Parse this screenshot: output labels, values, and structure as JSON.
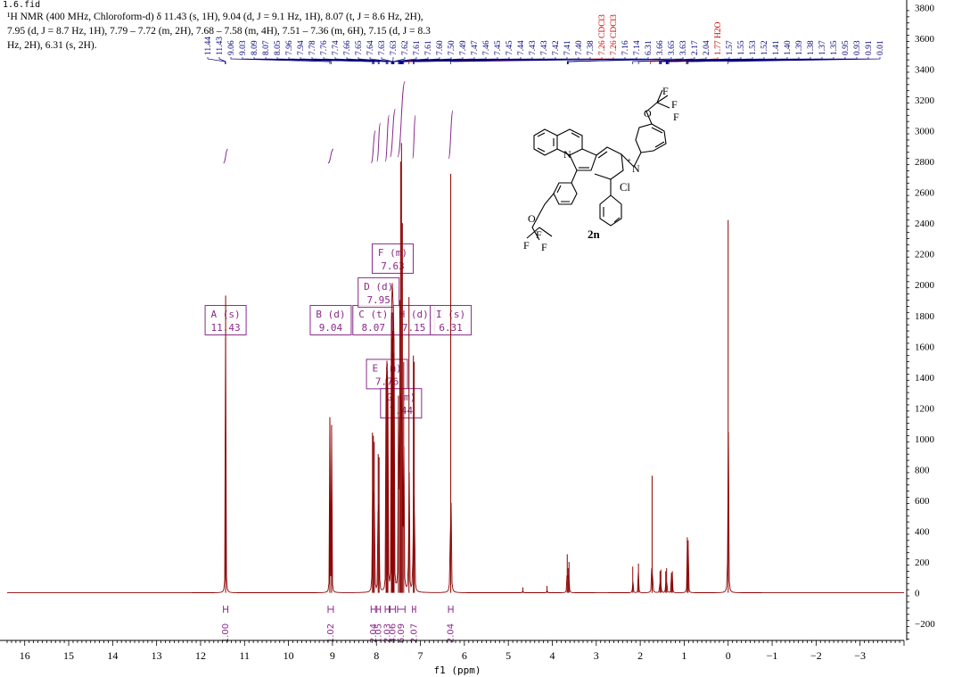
{
  "file_name": "1.6.fid",
  "header_lines": [
    "¹H NMR (400 MHz, Chloroform-d) δ 11.43 (s, 1H), 9.04 (d, J = 9.1 Hz, 1H), 8.07 (t, J = 8.6 Hz, 2H),",
    "7.95 (d, J = 8.7 Hz, 1H), 7.79 – 7.72 (m, 2H), 7.68 – 7.58 (m, 4H), 7.51 – 7.36 (m, 6H), 7.15 (d, J = 8.3",
    "Hz, 2H), 6.31 (s, 2H)."
  ],
  "colors": {
    "spectrum": "#8b0000",
    "multiplet": "#8a2a8a",
    "peak_label": "#00007f",
    "solvent_label": "#cc0000",
    "axis": "#000000"
  },
  "structure": {
    "compound_label": "2n",
    "atoms": [
      "N",
      "+",
      "N",
      "Cl",
      "O",
      "F",
      "F",
      "F",
      "O",
      "F",
      "F",
      "F"
    ]
  },
  "chart_data": {
    "type": "line",
    "title": "",
    "xlabel": "f1 (ppm)",
    "ylabel": "",
    "xlim": [
      16.4,
      -4.0
    ],
    "ylim": [
      -350,
      3820
    ],
    "x_reversed": true,
    "xticks": [
      16,
      15,
      14,
      13,
      12,
      11,
      10,
      9,
      8,
      7,
      6,
      5,
      4,
      3,
      2,
      1,
      0,
      -1,
      -2,
      -3
    ],
    "xtick_labels": [
      "16",
      "15",
      "14",
      "13",
      "12",
      "11",
      "10",
      "9",
      "8",
      "7",
      "6",
      "5",
      "4",
      "3",
      "2",
      "1",
      "0",
      "−1",
      "−2",
      "−3"
    ],
    "yticks": [
      -200,
      0,
      200,
      400,
      600,
      800,
      1000,
      1200,
      1400,
      1600,
      1800,
      2000,
      2200,
      2400,
      2600,
      2800,
      3000,
      3200,
      3400,
      3600,
      3800
    ],
    "ytick_labels": [
      "−200",
      "0",
      "200",
      "400",
      "600",
      "800",
      "1000",
      "1200",
      "1400",
      "1600",
      "1800",
      "2000",
      "2200",
      "2400",
      "2600",
      "2800",
      "3000",
      "3200",
      "3400",
      "3600",
      "3800"
    ],
    "peaks": [
      {
        "ppm": 11.43,
        "height": 1930
      },
      {
        "ppm": 9.06,
        "height": 1140
      },
      {
        "ppm": 9.02,
        "height": 1090
      },
      {
        "ppm": 8.09,
        "height": 1040
      },
      {
        "ppm": 8.07,
        "height": 1020
      },
      {
        "ppm": 8.05,
        "height": 980
      },
      {
        "ppm": 7.96,
        "height": 900
      },
      {
        "ppm": 7.94,
        "height": 880
      },
      {
        "ppm": 7.78,
        "height": 1390
      },
      {
        "ppm": 7.76,
        "height": 1500
      },
      {
        "ppm": 7.74,
        "height": 1280
      },
      {
        "ppm": 7.66,
        "height": 1650
      },
      {
        "ppm": 7.64,
        "height": 1820
      },
      {
        "ppm": 7.62,
        "height": 1700
      },
      {
        "ppm": 7.6,
        "height": 1560
      },
      {
        "ppm": 7.5,
        "height": 1280
      },
      {
        "ppm": 7.47,
        "height": 1900
      },
      {
        "ppm": 7.45,
        "height": 2800
      },
      {
        "ppm": 7.43,
        "height": 2920
      },
      {
        "ppm": 7.41,
        "height": 2400
      },
      {
        "ppm": 7.38,
        "height": 1500
      },
      {
        "ppm": 7.26,
        "height": 1920
      },
      {
        "ppm": 7.16,
        "height": 1540
      },
      {
        "ppm": 7.14,
        "height": 1500
      },
      {
        "ppm": 6.31,
        "height": 2720
      },
      {
        "ppm": 4.67,
        "height": 35
      },
      {
        "ppm": 4.12,
        "height": 45
      },
      {
        "ppm": 3.66,
        "height": 250
      },
      {
        "ppm": 3.64,
        "height": 160
      },
      {
        "ppm": 3.62,
        "height": 200
      },
      {
        "ppm": 2.17,
        "height": 170
      },
      {
        "ppm": 2.04,
        "height": 190
      },
      {
        "ppm": 1.73,
        "height": 760
      },
      {
        "ppm": 1.55,
        "height": 140
      },
      {
        "ppm": 1.53,
        "height": 150
      },
      {
        "ppm": 1.42,
        "height": 140
      },
      {
        "ppm": 1.4,
        "height": 160
      },
      {
        "ppm": 1.29,
        "height": 130
      },
      {
        "ppm": 1.27,
        "height": 140
      },
      {
        "ppm": 0.93,
        "height": 360
      },
      {
        "ppm": 0.91,
        "height": 340
      },
      {
        "ppm": 0.0,
        "height": 2420
      }
    ],
    "peak_labels": [
      {
        "text": "11.44",
        "ppm": 11.44,
        "solvent": false
      },
      {
        "text": "11.43",
        "ppm": 11.43,
        "solvent": false
      },
      {
        "text": "9.06",
        "ppm": 9.06,
        "solvent": false
      },
      {
        "text": "9.03",
        "ppm": 9.03,
        "solvent": false
      },
      {
        "text": "8.09",
        "ppm": 8.09,
        "solvent": false
      },
      {
        "text": "8.07",
        "ppm": 8.07,
        "solvent": false
      },
      {
        "text": "8.05",
        "ppm": 8.05,
        "solvent": false
      },
      {
        "text": "7.96",
        "ppm": 7.96,
        "solvent": false
      },
      {
        "text": "7.94",
        "ppm": 7.94,
        "solvent": false
      },
      {
        "text": "7.78",
        "ppm": 7.78,
        "solvent": false
      },
      {
        "text": "7.76",
        "ppm": 7.76,
        "solvent": false
      },
      {
        "text": "7.74",
        "ppm": 7.74,
        "solvent": false
      },
      {
        "text": "7.66",
        "ppm": 7.66,
        "solvent": false
      },
      {
        "text": "7.65",
        "ppm": 7.65,
        "solvent": false
      },
      {
        "text": "7.64",
        "ppm": 7.64,
        "solvent": false
      },
      {
        "text": "7.63",
        "ppm": 7.63,
        "solvent": false
      },
      {
        "text": "7.63",
        "ppm": 7.63,
        "solvent": false
      },
      {
        "text": "7.62",
        "ppm": 7.62,
        "solvent": false
      },
      {
        "text": "7.61",
        "ppm": 7.61,
        "solvent": false
      },
      {
        "text": "7.61",
        "ppm": 7.61,
        "solvent": false
      },
      {
        "text": "7.60",
        "ppm": 7.6,
        "solvent": false
      },
      {
        "text": "7.50",
        "ppm": 7.5,
        "solvent": false
      },
      {
        "text": "7.49",
        "ppm": 7.49,
        "solvent": false
      },
      {
        "text": "7.47",
        "ppm": 7.47,
        "solvent": false
      },
      {
        "text": "7.46",
        "ppm": 7.46,
        "solvent": false
      },
      {
        "text": "7.45",
        "ppm": 7.45,
        "solvent": false
      },
      {
        "text": "7.45",
        "ppm": 7.45,
        "solvent": false
      },
      {
        "text": "7.44",
        "ppm": 7.44,
        "solvent": false
      },
      {
        "text": "7.43",
        "ppm": 7.43,
        "solvent": false
      },
      {
        "text": "7.43",
        "ppm": 7.43,
        "solvent": false
      },
      {
        "text": "7.42",
        "ppm": 7.42,
        "solvent": false
      },
      {
        "text": "7.41",
        "ppm": 7.41,
        "solvent": false
      },
      {
        "text": "7.40",
        "ppm": 7.4,
        "solvent": false
      },
      {
        "text": "7.38",
        "ppm": 7.38,
        "solvent": false
      },
      {
        "text": "7.26 CDCl3",
        "ppm": 7.26,
        "solvent": true
      },
      {
        "text": "7.26 CDCl3",
        "ppm": 7.26,
        "solvent": true
      },
      {
        "text": "7.16",
        "ppm": 7.16,
        "solvent": false
      },
      {
        "text": "7.14",
        "ppm": 7.14,
        "solvent": false
      },
      {
        "text": "6.31",
        "ppm": 6.31,
        "solvent": false
      },
      {
        "text": "3.66",
        "ppm": 3.66,
        "solvent": false
      },
      {
        "text": "3.65",
        "ppm": 3.65,
        "solvent": false
      },
      {
        "text": "3.63",
        "ppm": 3.63,
        "solvent": false
      },
      {
        "text": "2.17",
        "ppm": 2.17,
        "solvent": false
      },
      {
        "text": "2.04",
        "ppm": 2.04,
        "solvent": false
      },
      {
        "text": "1.77 H2O",
        "ppm": 1.77,
        "solvent": true
      },
      {
        "text": "1.57",
        "ppm": 1.57,
        "solvent": false
      },
      {
        "text": "1.55",
        "ppm": 1.55,
        "solvent": false
      },
      {
        "text": "1.53",
        "ppm": 1.53,
        "solvent": false
      },
      {
        "text": "1.52",
        "ppm": 1.52,
        "solvent": false
      },
      {
        "text": "1.41",
        "ppm": 1.41,
        "solvent": false
      },
      {
        "text": "1.40",
        "ppm": 1.4,
        "solvent": false
      },
      {
        "text": "1.39",
        "ppm": 1.39,
        "solvent": false
      },
      {
        "text": "1.38",
        "ppm": 1.38,
        "solvent": false
      },
      {
        "text": "1.37",
        "ppm": 1.37,
        "solvent": false
      },
      {
        "text": "1.35",
        "ppm": 1.35,
        "solvent": false
      },
      {
        "text": "0.95",
        "ppm": 0.95,
        "solvent": false
      },
      {
        "text": "0.93",
        "ppm": 0.93,
        "solvent": false
      },
      {
        "text": "0.91",
        "ppm": 0.91,
        "solvent": false
      },
      {
        "text": "0.01",
        "ppm": 0.01,
        "solvent": false
      }
    ],
    "multiplets": [
      {
        "id": "A",
        "mult": "(s)",
        "shift": "11.43",
        "ppm": 11.43,
        "label_y": 1770
      },
      {
        "id": "B",
        "mult": "(d)",
        "shift": "9.04",
        "ppm": 9.04,
        "label_y": 1770
      },
      {
        "id": "C",
        "mult": "(t)",
        "shift": "8.07",
        "ppm": 8.07,
        "label_y": 1770
      },
      {
        "id": "D",
        "mult": "(d)",
        "shift": "7.95",
        "ppm": 7.95,
        "label_y": 1950
      },
      {
        "id": "E",
        "mult": "(m)",
        "shift": "7.76",
        "ppm": 7.76,
        "label_y": 1420
      },
      {
        "id": "F",
        "mult": "(m)",
        "shift": "7.63",
        "ppm": 7.63,
        "label_y": 2170
      },
      {
        "id": "G",
        "mult": "(m)",
        "shift": "7.44",
        "ppm": 7.44,
        "label_y": 1230
      },
      {
        "id": "H",
        "mult": "(d)",
        "shift": "7.15",
        "ppm": 7.15,
        "label_y": 1770
      },
      {
        "id": "I",
        "mult": "(s)",
        "shift": "6.31",
        "ppm": 6.31,
        "label_y": 1770
      }
    ],
    "integrals": [
      {
        "from": 11.48,
        "to": 11.38,
        "value": "1.00",
        "curve_y": [
          2790,
          2880
        ]
      },
      {
        "from": 9.1,
        "to": 8.98,
        "value": "1.02",
        "curve_y": [
          2790,
          2880
        ]
      },
      {
        "from": 8.12,
        "to": 8.02,
        "value": "2.04",
        "curve_y": [
          2790,
          3000
        ]
      },
      {
        "from": 7.99,
        "to": 7.91,
        "value": "1.05",
        "curve_y": [
          2800,
          3050
        ]
      },
      {
        "from": 7.8,
        "to": 7.71,
        "value": "2.03",
        "curve_y": [
          2800,
          3100
        ]
      },
      {
        "from": 7.69,
        "to": 7.57,
        "value": "4.06",
        "curve_y": [
          2830,
          3140
        ]
      },
      {
        "from": 7.52,
        "to": 7.35,
        "value": "6.09",
        "curve_y": [
          2830,
          3320
        ]
      },
      {
        "from": 7.18,
        "to": 7.11,
        "value": "2.07",
        "curve_y": [
          2820,
          3100
        ]
      },
      {
        "from": 6.36,
        "to": 6.26,
        "value": "2.04",
        "curve_y": [
          2820,
          3130
        ]
      }
    ]
  }
}
